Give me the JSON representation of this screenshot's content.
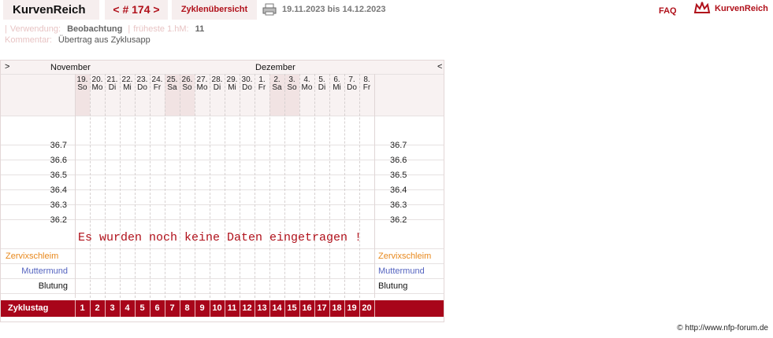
{
  "header": {
    "logo": "KurvenReich",
    "cycle_nav": "< # 174 >",
    "overview_link": "Zyklenübersicht",
    "print_icon": "printer-icon",
    "date_range": "19.11.2023 bis 14.12.2023",
    "faq": "FAQ",
    "brand_icon": "crown-icon",
    "brand_name": "KurvenReich"
  },
  "meta": {
    "verwendung_label": "Verwendung:",
    "verwendung_value": "Beobachtung",
    "frueheste_label": "früheste 1.hM:",
    "frueheste_value": "11",
    "kommentar_label": "Kommentar:",
    "kommentar_value": "Übertrag aus Zyklusapp"
  },
  "chart": {
    "nav_left": ">",
    "nav_right": "<",
    "months": [
      {
        "name": "November"
      },
      {
        "name": "Dezember"
      }
    ],
    "days": [
      {
        "date": "19.",
        "dow": "So",
        "weekend": true
      },
      {
        "date": "20.",
        "dow": "Mo",
        "weekend": false
      },
      {
        "date": "21.",
        "dow": "Di",
        "weekend": false
      },
      {
        "date": "22.",
        "dow": "Mi",
        "weekend": false
      },
      {
        "date": "23.",
        "dow": "Do",
        "weekend": false
      },
      {
        "date": "24.",
        "dow": "Fr",
        "weekend": false
      },
      {
        "date": "25.",
        "dow": "Sa",
        "weekend": true
      },
      {
        "date": "26.",
        "dow": "So",
        "weekend": true
      },
      {
        "date": "27.",
        "dow": "Mo",
        "weekend": false
      },
      {
        "date": "28.",
        "dow": "Di",
        "weekend": false
      },
      {
        "date": "29.",
        "dow": "Mi",
        "weekend": false
      },
      {
        "date": "30.",
        "dow": "Do",
        "weekend": false
      },
      {
        "date": "1.",
        "dow": "Fr",
        "weekend": false
      },
      {
        "date": "2.",
        "dow": "Sa",
        "weekend": true
      },
      {
        "date": "3.",
        "dow": "So",
        "weekend": true
      },
      {
        "date": "4.",
        "dow": "Mo",
        "weekend": false
      },
      {
        "date": "5.",
        "dow": "Di",
        "weekend": false
      },
      {
        "date": "6.",
        "dow": "Mi",
        "weekend": false
      },
      {
        "date": "7.",
        "dow": "Do",
        "weekend": false
      },
      {
        "date": "8.",
        "dow": "Fr",
        "weekend": false
      }
    ],
    "temperature_ticks": [
      "36.7",
      "36.6",
      "36.5",
      "36.4",
      "36.3",
      "36.2"
    ],
    "no_data_message": "Es wurden noch keine Daten eingetragen !",
    "rows": {
      "zervix": "Zervixschleim",
      "muttermund": "Muttermund",
      "blutung": "Blutung"
    },
    "row_colors": {
      "zervix": "#e8881c",
      "muttermund": "#5564c0",
      "blutung": "#111111"
    },
    "cycle_label": "Zyklustag",
    "cycle_days": [
      "1",
      "2",
      "3",
      "4",
      "5",
      "6",
      "7",
      "8",
      "9",
      "10",
      "11",
      "12",
      "13",
      "14",
      "15",
      "16",
      "17",
      "18",
      "19",
      "20"
    ]
  },
  "chart_data": {
    "type": "line",
    "x": [
      "19.11.",
      "20.11.",
      "21.11.",
      "22.11.",
      "23.11.",
      "24.11.",
      "25.11.",
      "26.11.",
      "27.11.",
      "28.11.",
      "29.11.",
      "30.11.",
      "1.12.",
      "2.12.",
      "3.12.",
      "4.12.",
      "5.12.",
      "6.12.",
      "7.12.",
      "8.12."
    ],
    "series": [],
    "ylim": [
      36.2,
      36.7
    ],
    "grid": true
  },
  "footer": {
    "copyright": "© http://www.nfp-forum.de"
  },
  "colors": {
    "accent": "#b0101a",
    "cycle_bar": "#a8051a",
    "panel": "#f6eeee"
  }
}
